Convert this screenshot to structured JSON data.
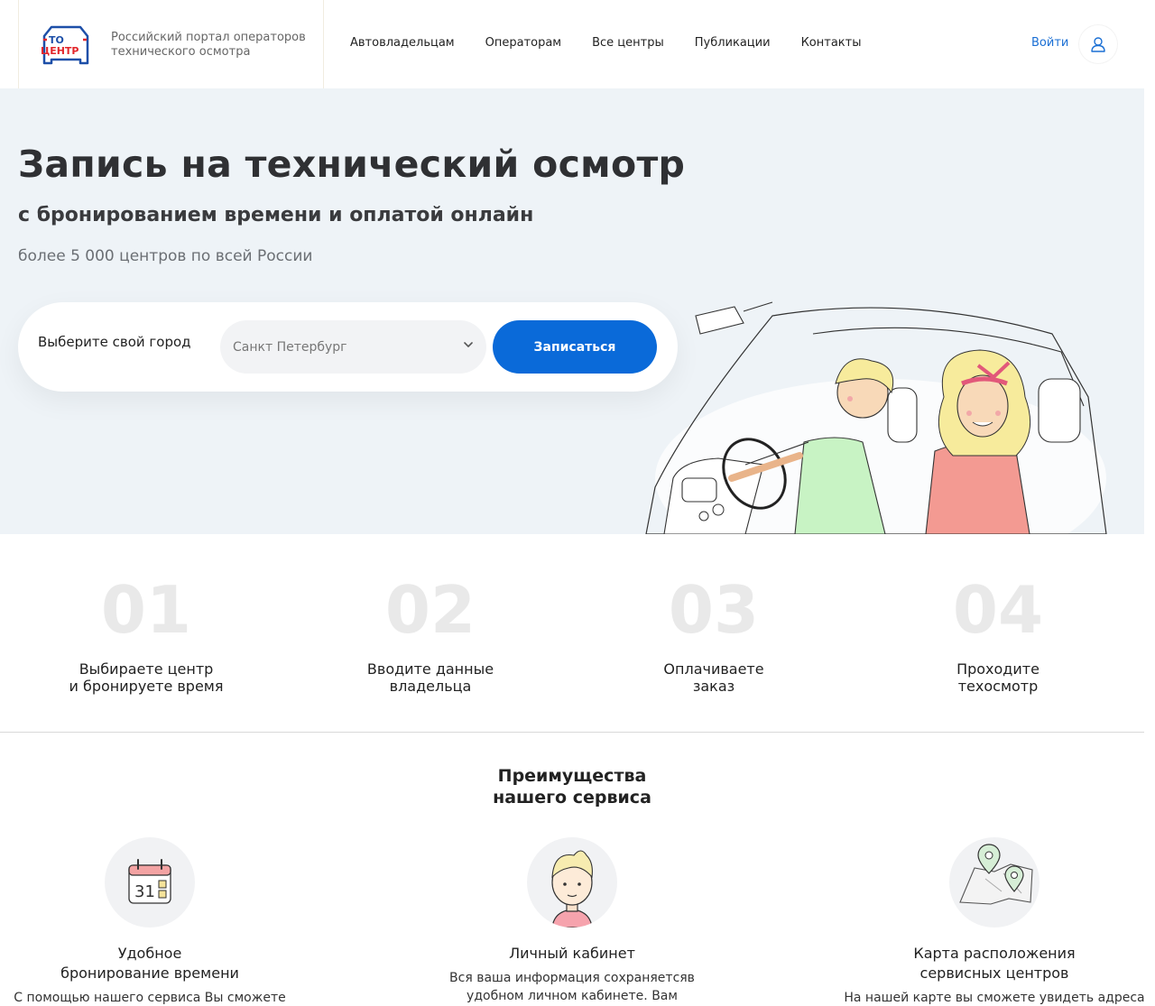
{
  "header": {
    "logo_top": "ТО",
    "logo_bottom": "ЦЕНТР",
    "tagline": "Российский портал операторов технического осмотра",
    "nav": [
      "Автовладельцам",
      "Операторам",
      "Все центры",
      "Публикации",
      "Контакты"
    ],
    "login": "Войти",
    "icons": {
      "user": "user-icon"
    }
  },
  "hero": {
    "title": "Запись на технический осмотр",
    "subtitle": "с бронированием времени и оплатой онлайн",
    "note": "более 5 000 центров по всей России",
    "search": {
      "label": "Выберите свой город",
      "city_value": "Санкт Петербург",
      "button": "Записаться"
    }
  },
  "steps": [
    {
      "num": "01",
      "text_l1": "Выбираете центр",
      "text_l2": "и бронируете время"
    },
    {
      "num": "02",
      "text_l1": "Вводите данные",
      "text_l2": "владельца"
    },
    {
      "num": "03",
      "text_l1": "Оплачиваете",
      "text_l2": "заказ"
    },
    {
      "num": "04",
      "text_l1": "Проходите",
      "text_l2": "техосмотр"
    }
  ],
  "advantages": {
    "title_l1": "Преимущества",
    "title_l2": "нашего сервиса",
    "items": [
      {
        "name_l1": "Удобное",
        "name_l2": "бронирование времени",
        "desc": "С помощью нашего сервиса Вы сможете",
        "icon": "calendar-icon"
      },
      {
        "name_l1": "Личный кабинет",
        "name_l2": "",
        "desc": "Вся ваша информация сохраняетсяв удобном личном кабинете. Вам большене",
        "icon": "person-icon"
      },
      {
        "name_l1": "Карта расположения",
        "name_l2": "сервисных центров",
        "desc": "На нашей карте вы сможете увидеть адреса",
        "icon": "map-icon"
      }
    ]
  },
  "colors": {
    "accent": "#0a6ad9",
    "hero_bg": "#eef3f7",
    "logo_red": "#e3262b",
    "logo_blue": "#1d4fa8"
  }
}
